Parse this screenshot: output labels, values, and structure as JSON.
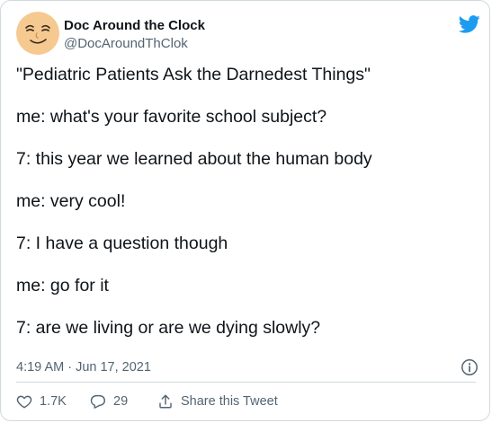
{
  "author": {
    "display_name": "Doc Around the Clock",
    "handle": "@DocAroundThClok",
    "avatar_icon": "smiley-face-avatar"
  },
  "brand": {
    "icon": "twitter-bird-icon",
    "color": "#1d9bf0"
  },
  "tweet": {
    "lines": [
      "\"Pediatric Patients Ask the Darnedest Things\"",
      "me: what's your favorite school subject?",
      "7: this year we learned about the human body",
      "me: very cool!",
      "7: I have a question though",
      "me: go for it",
      "7: are we living or are we dying slowly?"
    ],
    "timestamp": "4:19 AM · Jun 17, 2021"
  },
  "actions": {
    "likes": "1.7K",
    "replies": "29",
    "share_label": "Share this Tweet"
  },
  "colors": {
    "text": "#0f1419",
    "secondary": "#536471",
    "border": "#cfd9de",
    "avatar_fill": "#f5c990"
  }
}
